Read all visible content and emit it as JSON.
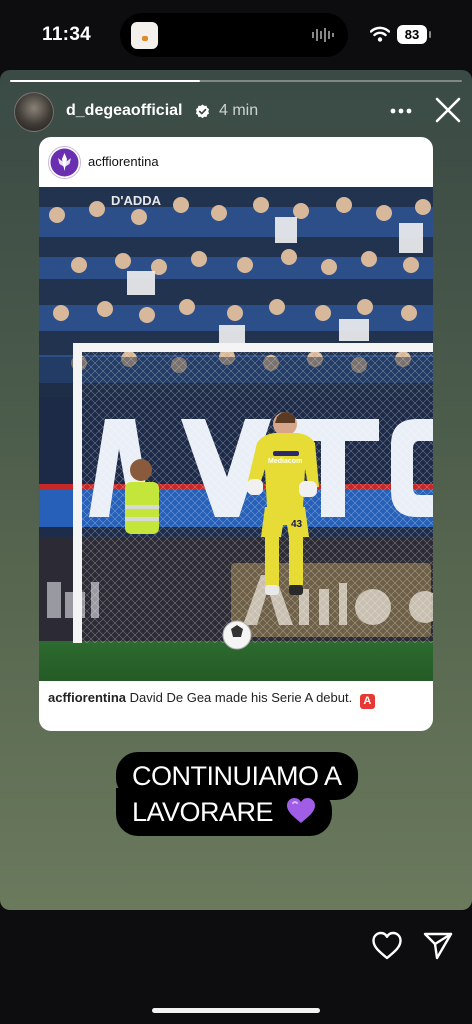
{
  "status_bar": {
    "time": "11:34",
    "battery": "83"
  },
  "story": {
    "progress": 0.42,
    "username": "d_degeaofficial",
    "time_ago": "4 min"
  },
  "post": {
    "account": "acffiorentina",
    "banner_text": "D'ADDA",
    "caption_user": "acffiorentina",
    "caption_text": "David De Gea made his Serie A debut.",
    "badge": "A",
    "shirt_sponsor": "Mediacom",
    "shirt_number": "43"
  },
  "sticker": {
    "line1": "CONTINUIAMO A",
    "line2": "LAVORARE"
  },
  "colors": {
    "accent_purple": "#8a4fd6",
    "kit_yellow": "#e6dc35",
    "badge_red": "#e53935"
  }
}
